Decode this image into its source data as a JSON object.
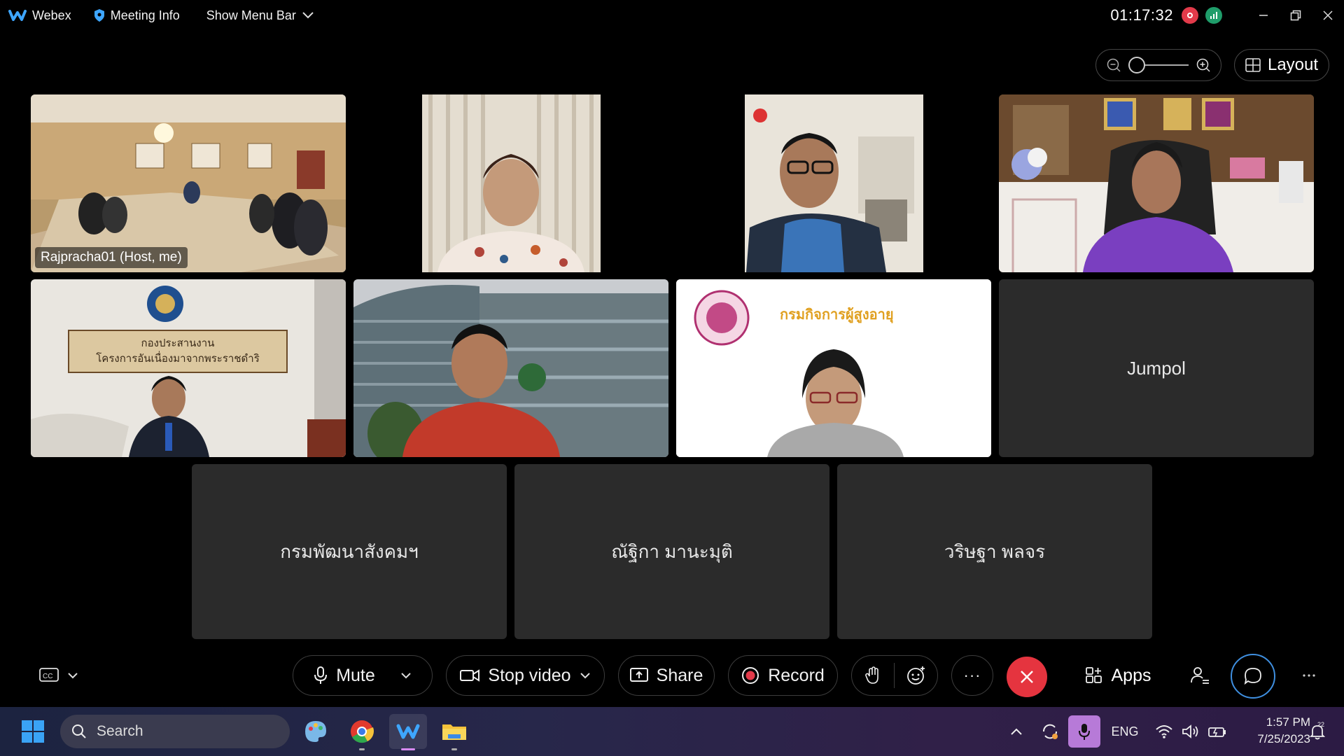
{
  "titlebar": {
    "app_name": "Webex",
    "meeting_info": "Meeting Info",
    "menu_bar": "Show Menu Bar",
    "elapsed": "01:17:32"
  },
  "toolbar_top": {
    "layout_label": "Layout"
  },
  "participants": [
    {
      "label": "Rajpracha01 (Host, me)",
      "video": true,
      "active": true
    },
    {
      "label": "",
      "video": true
    },
    {
      "label": "",
      "video": true
    },
    {
      "label": "",
      "video": true
    },
    {
      "label": "",
      "video": true,
      "sign_line1": "กองประสานงาน",
      "sign_line2": "โครงการอันเนื่องมาจากพระราชดำริ"
    },
    {
      "label": "",
      "video": true
    },
    {
      "label": "",
      "video": true,
      "slide_text": "กรมกิจการผู้สูงอายุ"
    },
    {
      "label": "Jumpol",
      "video": false
    },
    {
      "label": "กรมพัฒนาสังคมฯ",
      "video": false
    },
    {
      "label": "ณัฐิกา มานะมุติ",
      "video": false
    },
    {
      "label": "วริษฐา พลจร",
      "video": false
    }
  ],
  "controls": {
    "mute": "Mute",
    "stop_video": "Stop video",
    "share": "Share",
    "record": "Record",
    "apps": "Apps",
    "more": "···"
  },
  "taskbar": {
    "search_placeholder": "Search",
    "language": "ENG",
    "time": "1:57 PM",
    "date": "7/25/2023",
    "notification_count": "22"
  },
  "colors": {
    "accent": "#4aa3ff",
    "end_call": "#e5343f",
    "recording": "#e23a4a"
  }
}
